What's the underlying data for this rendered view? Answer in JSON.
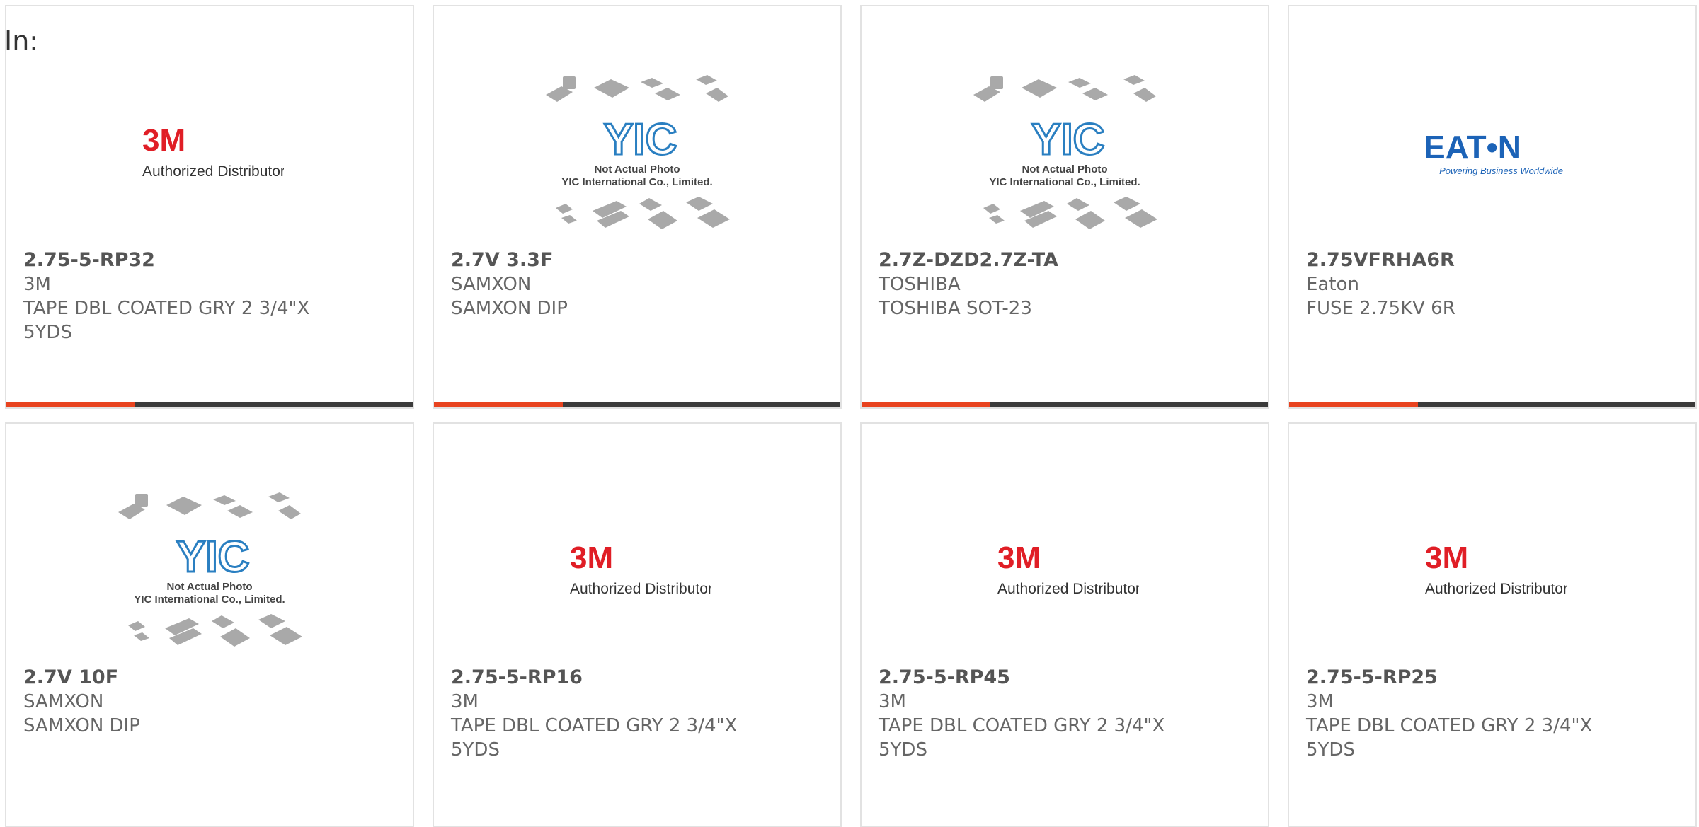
{
  "page": {
    "label": "In:"
  },
  "colors": {
    "accent": "#e8431f",
    "bar": "#3b3b3b",
    "border": "#e2e2e2",
    "brand_3m": "#e01e26",
    "brand_eaton": "#1c63b7",
    "brand_yic": "#2a7fc1"
  },
  "logos": {
    "m3": {
      "mark": "3M",
      "tagline": "Authorized Distributor"
    },
    "eaton": {
      "mark": "EAT•N",
      "tagline": "Powering Business Worldwide"
    },
    "yic": {
      "mark": "YIC",
      "line1": "Not Actual Photo",
      "line2": "YIC International Co., Limited."
    }
  },
  "products": [
    {
      "part_number": "2.75-5-RP32",
      "manufacturer": "3M",
      "description": "TAPE DBL COATED GRY 2 3/4\"X 5YDS",
      "image": "3m-logo"
    },
    {
      "part_number": "2.7V 3.3F",
      "manufacturer": "SAMXON",
      "description": "SAMXON DIP",
      "image": "yic-placeholder"
    },
    {
      "part_number": "2.7Z-DZD2.7Z-TA",
      "manufacturer": "TOSHIBA",
      "description": "TOSHIBA SOT-23",
      "image": "yic-placeholder"
    },
    {
      "part_number": "2.75VFRHA6R",
      "manufacturer": "Eaton",
      "description": "FUSE 2.75KV 6R",
      "image": "eaton-logo"
    },
    {
      "part_number": "2.7V 10F",
      "manufacturer": "SAMXON",
      "description": "SAMXON DIP",
      "image": "yic-placeholder"
    },
    {
      "part_number": "2.75-5-RP16",
      "manufacturer": "3M",
      "description": "TAPE DBL COATED GRY 2 3/4\"X 5YDS",
      "image": "3m-logo"
    },
    {
      "part_number": "2.75-5-RP45",
      "manufacturer": "3M",
      "description": "TAPE DBL COATED GRY 2 3/4\"X 5YDS",
      "image": "3m-logo"
    },
    {
      "part_number": "2.75-5-RP25",
      "manufacturer": "3M",
      "description": "TAPE DBL COATED GRY 2 3/4\"X 5YDS",
      "image": "3m-logo"
    }
  ]
}
